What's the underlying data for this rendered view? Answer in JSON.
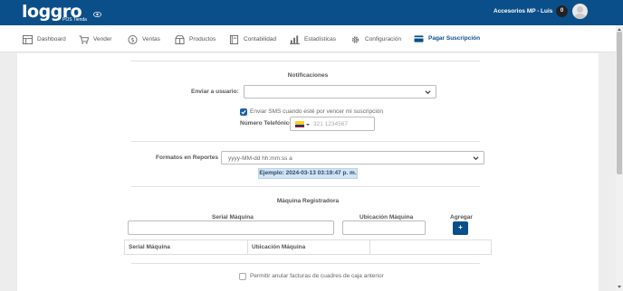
{
  "header": {
    "logo_text": "loggro",
    "logo_subtitle": "POS Tienda",
    "store": "Accesorios MP -",
    "user": "Luis",
    "notification_count": "0"
  },
  "nav": {
    "items": [
      {
        "label": "Dashboard",
        "icon": "dashboard-icon"
      },
      {
        "label": "Vender",
        "icon": "cart-icon"
      },
      {
        "label": "Ventas",
        "icon": "dollar-icon"
      },
      {
        "label": "Productos",
        "icon": "products-icon"
      },
      {
        "label": "Contabilidad",
        "icon": "book-icon"
      },
      {
        "label": "Estadísticas",
        "icon": "bar-chart-icon"
      },
      {
        "label": "Configuración",
        "icon": "gear-icon"
      },
      {
        "label": "Pagar Suscripción",
        "icon": "credit-card-icon"
      }
    ],
    "active": "Pagar Suscripción"
  },
  "notifications": {
    "title": "Notificaciones",
    "send_to_label": "Enviar a usuario:",
    "send_to_value": "",
    "sms_label": "Enviar SMS cuando esté por vencer mi suscripción",
    "sms_checked": true,
    "phone_label": "Número Telefónico",
    "phone_placeholder": "321 1234567",
    "phone_value": ""
  },
  "reports": {
    "label": "Formatos en Reportes",
    "format_value": "yyyy-MM-dd hh:mm:ss a",
    "example": "Ejemplo: 2024-03-13 03:19:47 p. m."
  },
  "machines": {
    "title": "Máquina Registradora",
    "serial_label": "Serial Máquina",
    "location_label": "Ubicación Máquina",
    "add_label": "Agregar",
    "add_button": "+",
    "table_headers": [
      "Serial Máquina",
      "Ubicación Máquina",
      ""
    ]
  },
  "cancel_invoices": {
    "label": "Permitir anular facturas de cuadres de caja anterior",
    "checked": false
  },
  "colors": {
    "brand": "#0b4f8a",
    "checkbox": "#1a5fa8",
    "example_bg": "#d3e4f3"
  }
}
